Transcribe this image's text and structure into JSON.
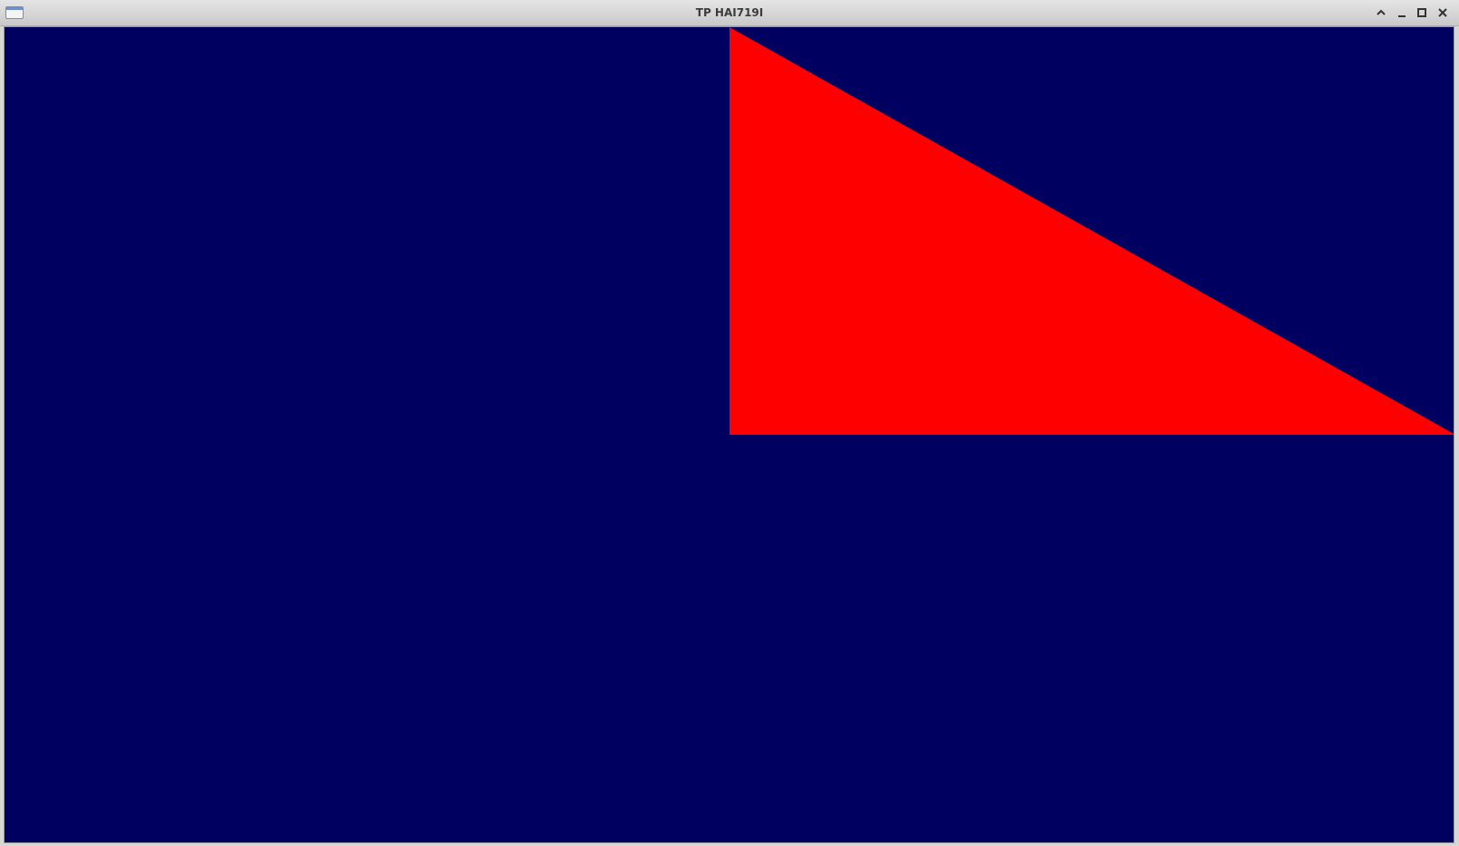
{
  "window": {
    "title": "TP HAI719I",
    "icons": {
      "app": "window-app-icon",
      "shade": "chevron-up-icon",
      "minimize": "minimize-icon",
      "maximize": "maximize-icon",
      "close": "close-icon"
    }
  },
  "scene": {
    "background_color": "#000060",
    "triangle_color": "#ff0000"
  }
}
